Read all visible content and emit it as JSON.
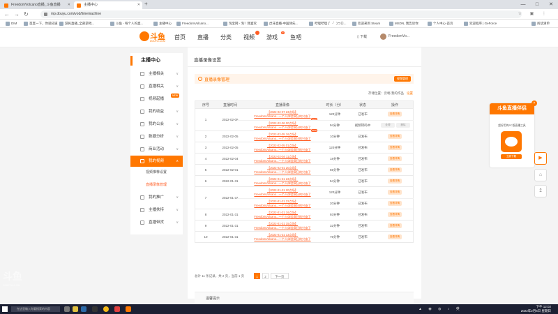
{
  "browser": {
    "tabs": [
      {
        "title": "FreedomVolcano直播_斗鱼直播",
        "active": false
      },
      {
        "title": "主播中心",
        "active": true
      }
    ],
    "new_tab": "+",
    "url": "mp.douyu.com/vod/timemachine",
    "window_controls": [
      "—",
      "□",
      "✕"
    ]
  },
  "bookmarks": [
    "DIM",
    "百度一下，你就知道",
    "游民直播_全部游戏...",
    "斗鱼 - 每个人的直...",
    "主播中心",
    "FreedomVolcano...",
    "淘宝网 - 淘！我喜欢",
    "虎牙直播-中国领先...",
    "哔哩哔哩 (゜-゜)つロ...",
    "欢迎来到 Steam",
    "MSDN, 我告诉你",
    "个人中心-首页",
    "欢迎程序 | GeForce",
    "阅读清单"
  ],
  "site": {
    "logo_text": "斗鱼",
    "logo_sub": "DOUYU.COM",
    "nav": [
      "首页",
      "直播",
      "分类",
      "视频",
      "游戏",
      "鱼吧"
    ],
    "right": {
      "download": "下载",
      "username": "FreedomVo..."
    }
  },
  "sidebar": {
    "title": "主播中心",
    "items": [
      {
        "label": "主播相关",
        "icon": "mic-icon"
      },
      {
        "label": "直播相关",
        "icon": "tv-icon"
      },
      {
        "label": "视频起播",
        "icon": "video-icon",
        "flag": "NEW"
      },
      {
        "label": "我的收益",
        "icon": "coin-icon"
      },
      {
        "label": "我的公会",
        "icon": "group-icon"
      },
      {
        "label": "数据分析",
        "icon": "chart-icon"
      },
      {
        "label": "商业活动",
        "icon": "shop-icon"
      },
      {
        "label": "我的视频",
        "icon": "film-icon",
        "active": true
      },
      {
        "label": "视频推荐设置",
        "sub": true
      },
      {
        "label": "直播录像管理",
        "sub": true,
        "active": true
      },
      {
        "label": "我的推广",
        "icon": "promo-icon"
      },
      {
        "label": "主播扶持",
        "icon": "support-icon"
      },
      {
        "label": "直播带货",
        "icon": "bag-icon"
      }
    ]
  },
  "main": {
    "panel_title": "直播录像设置",
    "section_title": "直播录像管理",
    "section_button": "视频管理",
    "storage_note": "存储位置：云端-我的作品",
    "storage_link": "设置",
    "columns": [
      "序号",
      "直播时间",
      "直播录像",
      "时长（分）",
      "状态",
      "操作"
    ],
    "rows": [
      {
        "no": "1",
        "date": "2022-02-05",
        "items": [
          {
            "t1": "【2022-02-07 23点场】",
            "t2": "FreedomVolcano...一个人体验疯狂的兴奋了",
            "new": true,
            "dur": "120分钟",
            "status": "已发布",
            "acts": [
              "查看详情"
            ]
          },
          {
            "t1": "【2022-02-06 00点场】",
            "t2": "FreedomVolcano...一个人体验疯狂的兴奋了",
            "new": true,
            "dur": "94分钟",
            "status": "视频转码中",
            "acts": [
              "处理",
              "删除"
            ]
          }
        ]
      },
      {
        "no": "2",
        "date": "2022-02-05",
        "items": [
          {
            "t1": "【2022-02-05 16点场】",
            "t2": "FreedomVolcano...一个人体验疯狂的兴奋了",
            "dur": "10分钟",
            "status": "已发布",
            "acts": [
              "查看详情"
            ]
          }
        ]
      },
      {
        "no": "3",
        "date": "2022-02-05",
        "items": [
          {
            "t1": "【2022-02-05 01点场】",
            "t2": "FreedomVolcano...一个人体验疯狂的兴奋了",
            "dur": "120分钟",
            "status": "已发布",
            "acts": [
              "查看详情"
            ]
          }
        ]
      },
      {
        "no": "4",
        "date": "2022-02-04",
        "items": [
          {
            "t1": "【2022-02-04 11点场】",
            "t2": "FreedomVolcano...一个人体验疯狂的兴奋了",
            "dur": "18分钟",
            "status": "已发布",
            "acts": [
              "查看详情"
            ]
          }
        ]
      },
      {
        "no": "5",
        "date": "2022-02-01",
        "items": [
          {
            "t1": "【2022-02-01 20点场】",
            "t2": "FreedomVolcano...一个人体验疯狂的兴奋了",
            "dur": "65分钟",
            "status": "已发布",
            "acts": [
              "查看详情"
            ]
          }
        ]
      },
      {
        "no": "6",
        "date": "2022-01-31",
        "items": [
          {
            "t1": "【2022-01-31 23点场】",
            "t2": "FreedomVolcano...一个人体验疯狂的兴奋了",
            "dur": "54分钟",
            "status": "已发布",
            "acts": [
              "查看详情"
            ]
          }
        ]
      },
      {
        "no": "7",
        "date": "2022-01-31",
        "items": [
          {
            "t1": "【2022-01-31 20点场】",
            "t2": "FreedomVolcano...一个人体验疯狂的兴奋了",
            "dur": "120分钟",
            "status": "已发布",
            "acts": [
              "查看详情"
            ]
          },
          {
            "t1": "【2022-01-31 22点场】",
            "t2": "FreedomVolcano...一个人体验疯狂的兴奋了",
            "dur": "20分钟",
            "status": "已发布",
            "acts": [
              "查看详情"
            ]
          }
        ]
      },
      {
        "no": "8",
        "date": "2022-01-31",
        "items": [
          {
            "t1": "【2022-01-31 16点场】",
            "t2": "FreedomVolcano...一个人体验疯狂的兴奋了",
            "dur": "93分钟",
            "status": "已发布",
            "acts": [
              "查看详情"
            ]
          }
        ]
      },
      {
        "no": "9",
        "date": "2022-01-31",
        "items": [
          {
            "t1": "【2022-01-31 15点场】",
            "t2": "FreedomVolcano...一个人体验疯狂的兴奋了",
            "dur": "32分钟",
            "status": "已发布",
            "acts": [
              "查看详情"
            ]
          }
        ]
      },
      {
        "no": "10",
        "date": "2022-01-31",
        "items": [
          {
            "t1": "【2022-01-31 13点场】",
            "t2": "FreedomVolcano...一个人体验疯狂的兴奋了",
            "dur": "75分钟",
            "status": "已发布",
            "acts": [
              "查看详情"
            ]
          }
        ]
      }
    ],
    "pager": {
      "summary": "总计 11 条记录，共 2 页，当前 1 页",
      "pages": [
        "1",
        "2"
      ],
      "next": "下一页"
    },
    "footer_panel": "温馨提示"
  },
  "promo": {
    "title": "斗鱼直播伴侣",
    "desc": "超好用的PC版直播工具",
    "download": "立即下载",
    "close": "×"
  },
  "float_buttons": [
    "▶",
    "⌂",
    "↥"
  ],
  "watermark": {
    "logo": "斗鱼",
    "sub": "DOUYU.COM"
  },
  "taskbar": {
    "search": "在这里输入你要搜索的内容",
    "time": "下午 12:02",
    "date": "2022年2月6日 星期日"
  },
  "colors": {
    "accent": "#ff7700",
    "link": "#ff5d23"
  }
}
